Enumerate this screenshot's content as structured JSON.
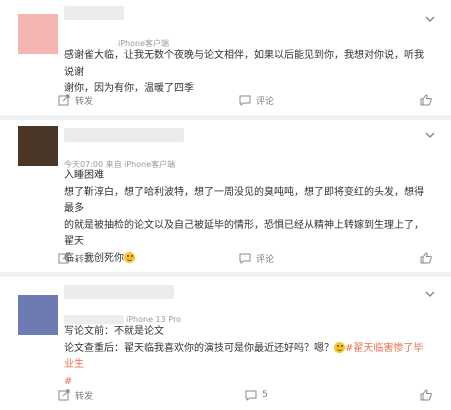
{
  "comments": [
    {
      "avatar_color": "#f5b5b0",
      "meta": "iPhone客户端",
      "lines": [
        "感谢雀大临，让我无数个夜晚与论文相伴，如果以后能见到你，我想对你说，听我说谢",
        "谢你，因为有你，温暖了四季"
      ],
      "actions": {
        "forward": "转发",
        "comment": "评论",
        "like": ""
      }
    },
    {
      "avatar_color": "#4a3626",
      "meta": "今天07:00  来自 iPhone客户端",
      "lines": [
        "入睡困难",
        "想了靳淳白，想了哈利波特，想了一周没见的臭吨吨，想了即将变红的头发，想得最多",
        "的就是被抽检的论文以及自己被延毕的情形，恐惧已经从精神上转嫁到生理上了，翟天",
        "临，我创死你"
      ],
      "actions": {
        "forward": "转发",
        "comment": "评论",
        "like": ""
      }
    },
    {
      "avatar_color": "#6e7bb3",
      "meta": "iPhone 13 Pro",
      "lines": [
        "写论文前：不就是论文",
        "论文查重后：翟天临我喜欢你的演技可是你最近还好吗？嗯？",
        "#"
      ],
      "hashtag": "#翟天临害惨了毕业生",
      "actions": {
        "forward": "转发",
        "comment": "5",
        "like": ""
      }
    }
  ]
}
